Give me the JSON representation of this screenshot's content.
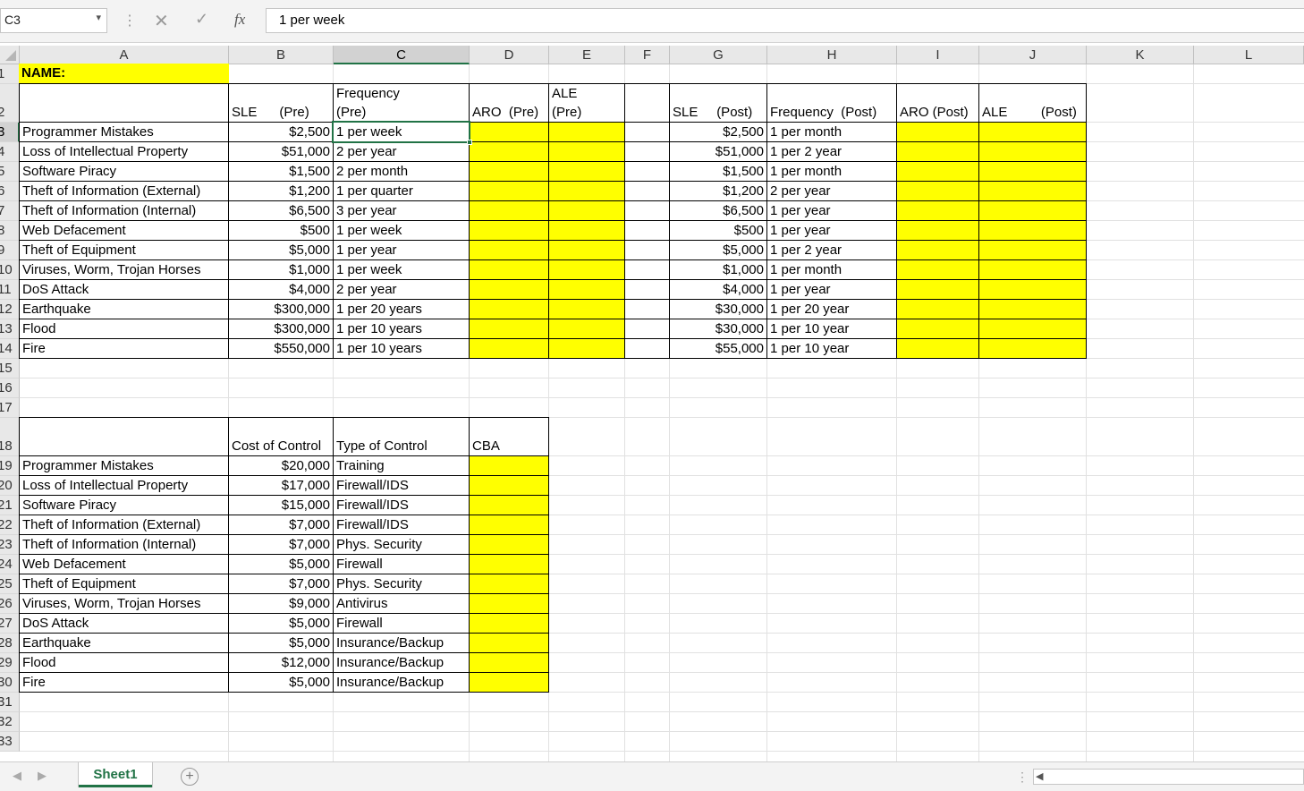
{
  "formula_bar": {
    "name_box": "C3",
    "fx_label": "fx",
    "formula": "1 per week"
  },
  "columns": [
    "A",
    "B",
    "C",
    "D",
    "E",
    "F",
    "G",
    "H",
    "I",
    "J",
    "K",
    "L"
  ],
  "rows": [
    "1",
    "2",
    "3",
    "4",
    "5",
    "6",
    "7",
    "8",
    "9",
    "10",
    "11",
    "12",
    "13",
    "14",
    "15",
    "16",
    "17",
    "18",
    "19",
    "20",
    "21",
    "22",
    "23",
    "24",
    "25",
    "26",
    "27",
    "28",
    "29",
    "30",
    "31",
    "32",
    "33"
  ],
  "name_label": "NAME:",
  "header_pre": {
    "sle": "SLE      (Pre)",
    "freq_line1": "Frequency",
    "freq_line2": "(Pre)",
    "aro": "ARO  (Pre)",
    "ale_line1": "ALE",
    "ale_line2": "(Pre)"
  },
  "header_post": {
    "sle": "SLE     (Post)",
    "freq": "Frequency  (Post)",
    "aro": "ARO (Post)",
    "ale": "ALE         (Post)"
  },
  "risks": [
    {
      "name": "Programmer Mistakes",
      "sle_pre": "$2,500",
      "freq_pre": "1 per week",
      "sle_post": "$2,500",
      "freq_post": "1 per month"
    },
    {
      "name": "Loss of Intellectual Property",
      "sle_pre": "$51,000",
      "freq_pre": "2 per year",
      "sle_post": "$51,000",
      "freq_post": "1 per 2 year"
    },
    {
      "name": "Software Piracy",
      "sle_pre": "$1,500",
      "freq_pre": "2 per month",
      "sle_post": "$1,500",
      "freq_post": "1 per month"
    },
    {
      "name": "Theft of Information (External)",
      "sle_pre": "$1,200",
      "freq_pre": "1 per quarter",
      "sle_post": "$1,200",
      "freq_post": "2 per year"
    },
    {
      "name": "Theft of Information (Internal)",
      "sle_pre": "$6,500",
      "freq_pre": "3 per year",
      "sle_post": "$6,500",
      "freq_post": "1 per year"
    },
    {
      "name": "Web Defacement",
      "sle_pre": "$500",
      "freq_pre": "1 per week",
      "sle_post": "$500",
      "freq_post": "1 per year"
    },
    {
      "name": "Theft of Equipment",
      "sle_pre": "$5,000",
      "freq_pre": "1 per year",
      "sle_post": "$5,000",
      "freq_post": "1 per 2 year"
    },
    {
      "name": "Viruses, Worm, Trojan Horses",
      "sle_pre": "$1,000",
      "freq_pre": "1 per week",
      "sle_post": "$1,000",
      "freq_post": "1 per month"
    },
    {
      "name": "DoS Attack",
      "sle_pre": "$4,000",
      "freq_pre": "2 per year",
      "sle_post": "$4,000",
      "freq_post": "1 per year"
    },
    {
      "name": "Earthquake",
      "sle_pre": "$300,000",
      "freq_pre": "1 per 20 years",
      "sle_post": "$30,000",
      "freq_post": "1 per 20 year"
    },
    {
      "name": "Flood",
      "sle_pre": "$300,000",
      "freq_pre": "1 per 10 years",
      "sle_post": "$30,000",
      "freq_post": "1 per 10 year"
    },
    {
      "name": "Fire",
      "sle_pre": "$550,000",
      "freq_pre": "1 per 10 years",
      "sle_post": "$55,000",
      "freq_post": "1 per 10 year"
    }
  ],
  "controls_header": {
    "cost": "Cost of Control",
    "type": "Type of Control",
    "cba": "CBA"
  },
  "controls": [
    {
      "name": "Programmer Mistakes",
      "cost": "$20,000",
      "type": "Training"
    },
    {
      "name": "Loss of Intellectual Property",
      "cost": "$17,000",
      "type": "Firewall/IDS"
    },
    {
      "name": "Software Piracy",
      "cost": "$15,000",
      "type": "Firewall/IDS"
    },
    {
      "name": "Theft of Information (External)",
      "cost": "$7,000",
      "type": "Firewall/IDS"
    },
    {
      "name": "Theft of Information (Internal)",
      "cost": "$7,000",
      "type": "Phys. Security"
    },
    {
      "name": "Web Defacement",
      "cost": "$5,000",
      "type": "Firewall"
    },
    {
      "name": "Theft of Equipment",
      "cost": "$7,000",
      "type": "Phys. Security"
    },
    {
      "name": "Viruses, Worm, Trojan Horses",
      "cost": "$9,000",
      "type": "Antivirus"
    },
    {
      "name": "DoS Attack",
      "cost": "$5,000",
      "type": "Firewall"
    },
    {
      "name": "Earthquake",
      "cost": "$5,000",
      "type": "Insurance/Backup"
    },
    {
      "name": "Flood",
      "cost": "$12,000",
      "type": "Insurance/Backup"
    },
    {
      "name": "Fire",
      "cost": "$5,000",
      "type": "Insurance/Backup"
    }
  ],
  "sheet_tab": "Sheet1",
  "colors": {
    "highlight": "#ffff00",
    "accent": "#217346"
  }
}
